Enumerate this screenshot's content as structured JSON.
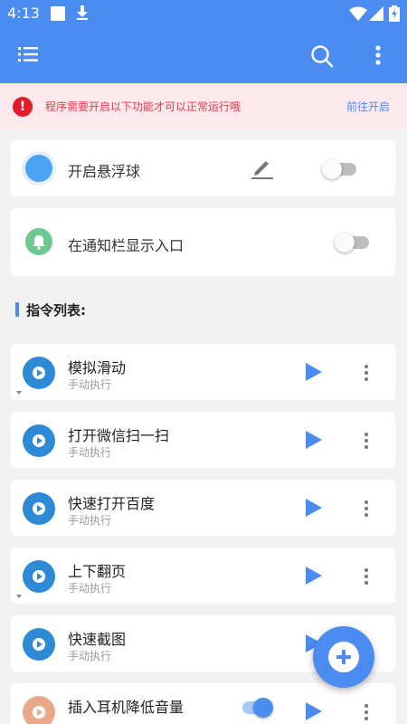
{
  "status_bar": {
    "time": "4:13"
  },
  "warning": {
    "icon": "!",
    "text": "程序需要开启以下功能才可以正常运行哦",
    "link": "前往开启"
  },
  "settings": {
    "floating_ball": {
      "label": "开启悬浮球",
      "enabled": false
    },
    "notification_entry": {
      "label": "在通知栏显示入口",
      "enabled": false
    }
  },
  "section_title": "指令列表:",
  "commands": [
    {
      "name": "模拟滑动",
      "mode": "手动执行"
    },
    {
      "name": "打开微信扫一扫",
      "mode": "手动执行"
    },
    {
      "name": "快速打开百度",
      "mode": "手动执行"
    },
    {
      "name": "上下翻页",
      "mode": "手动执行"
    },
    {
      "name": "快速截图",
      "mode": "手动执行"
    },
    {
      "name": "插入耳机降低音量",
      "mode": "",
      "enabled": true
    }
  ],
  "colors": {
    "primary": "#4a8cf0",
    "warning_bg": "#fde8ee",
    "warning_text": "#e23b4a",
    "error_icon": "#e21c2a"
  },
  "icons": [
    "menu-icon",
    "search-icon",
    "more-vert-icon",
    "pencil-icon",
    "play-icon",
    "kebab-icon",
    "add-icon",
    "bell-icon"
  ]
}
